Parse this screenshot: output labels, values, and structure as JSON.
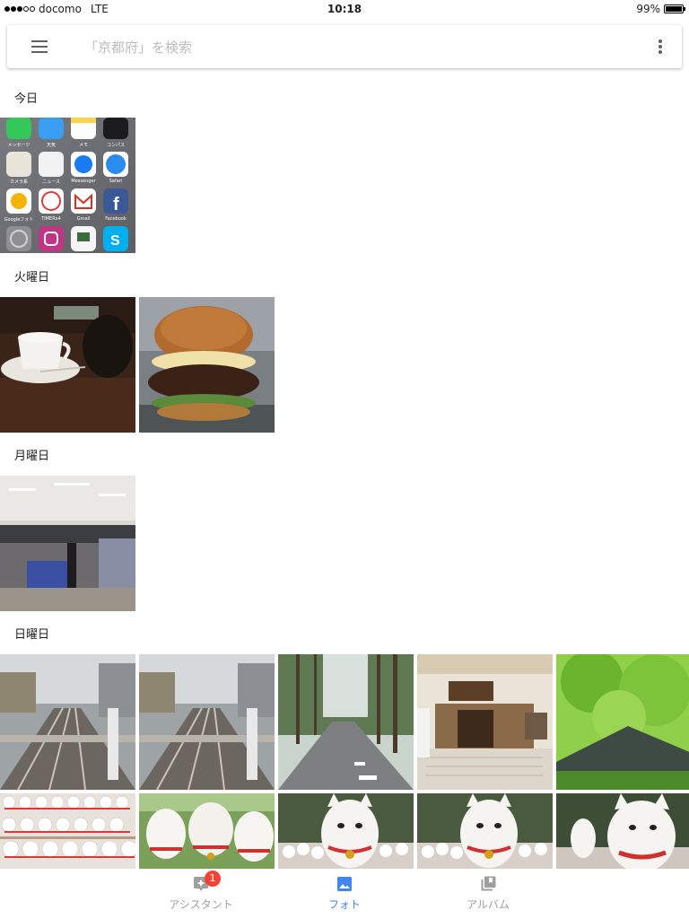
{
  "status_bar": {
    "carrier": "docomo",
    "network": "LTE",
    "time": "10:18",
    "battery": "99%",
    "battery_level": 0.99,
    "signal_bars_filled": 3,
    "signal_bars_total": 5
  },
  "search": {
    "placeholder": "「京都府」を検索"
  },
  "sections": [
    {
      "label": "今日",
      "photos": [
        "home-screen-screenshot"
      ]
    },
    {
      "label": "火曜日",
      "photos": [
        "coffee-cup",
        "hamburger"
      ]
    },
    {
      "label": "月曜日",
      "photos": [
        "bookstore"
      ]
    },
    {
      "label": "日曜日",
      "photos": [
        "railway-crossing",
        "railway-crossing-2",
        "tree-lined-road",
        "temple-entrance",
        "green-maple-tree",
        "maneki-neko-shelf",
        "maneki-neko-group",
        "maneki-neko-closeup",
        "maneki-neko-closeup-2",
        "maneki-neko-closeup-3"
      ]
    }
  ],
  "homescreen_apps": [
    "メッセージ",
    "天気",
    "メモ",
    "コンパス",
    "カメラ系",
    "ニュース",
    "Messenger",
    "Safari",
    "Googleフォト",
    "TIMERx4",
    "Gmail",
    "Facebook",
    "",
    "",
    "",
    ""
  ],
  "bottom_nav": {
    "tabs": [
      {
        "label": "アシスタント",
        "badge": "1",
        "icon": "assistant-icon"
      },
      {
        "label": "フォト",
        "icon": "photo-icon",
        "active": true
      },
      {
        "label": "アルバム",
        "icon": "album-icon"
      }
    ]
  },
  "colors": {
    "accent": "#4285f4",
    "badge": "#f44336",
    "inactive": "#9e9e9e"
  }
}
